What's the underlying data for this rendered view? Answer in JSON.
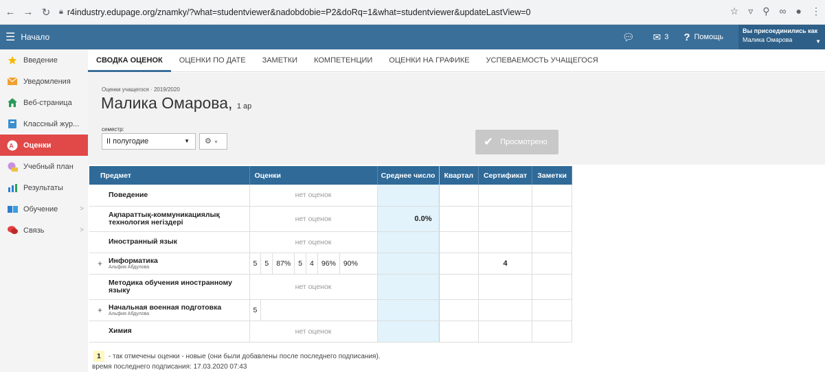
{
  "browser": {
    "url": "r4industry.edupage.org/znamky/?what=studentviewer&nadobdobie=P2&doRq=1&what=studentviewer&updateLastView=0"
  },
  "topbar": {
    "title": "Начало",
    "messages_count": "3",
    "help_label": "Помощь",
    "user_caption": "Вы присоединились как",
    "user_name": "Малика Омарова"
  },
  "sidebar": {
    "items": [
      {
        "label": "Введение",
        "icon": "star-icon"
      },
      {
        "label": "Уведомления",
        "icon": "mail-icon"
      },
      {
        "label": "Веб-страница",
        "icon": "home-icon"
      },
      {
        "label": "Классный жур...",
        "icon": "journal-icon"
      },
      {
        "label": "Оценки",
        "icon": "grades-icon"
      },
      {
        "label": "Учебный план",
        "icon": "plan-icon"
      },
      {
        "label": "Результаты",
        "icon": "bar-chart-icon"
      },
      {
        "label": "Обучение",
        "icon": "book-icon"
      },
      {
        "label": "Связь",
        "icon": "chat-icon"
      }
    ]
  },
  "tabs": [
    "СВОДКА ОЦЕНОК",
    "ОЦЕНКИ ПО ДАТЕ",
    "ЗАМЕТКИ",
    "КОМПЕТЕНЦИИ",
    "ОЦЕНКИ НА ГРАФИКЕ",
    "УСПЕВАЕМОСТЬ УЧАЩЕГОСЯ"
  ],
  "header": {
    "subtitle": "Оценки учащегося · 2019/2020",
    "student_name": "Малика Омарова,",
    "class": "1 ар",
    "semester_label": "семестр:",
    "semester_value": "II полугодие",
    "viewed_button": "Просмотрено"
  },
  "table": {
    "headers": {
      "subject": "Предмет",
      "grades": "Оценки",
      "average": "Среднее число",
      "quarter": "Квартал",
      "certificate": "Сертификат",
      "notes": "Заметки"
    },
    "rows": [
      {
        "subject": "Поведение",
        "teacher": "",
        "grades_text": "нет оценок",
        "average": "",
        "cert": ""
      },
      {
        "subject": "Ақпараттық-коммуникациялық технология негіздері",
        "teacher": "",
        "grades_text": "нет оценок",
        "average": "0.0%",
        "cert": ""
      },
      {
        "subject": "Иностранный язык",
        "teacher": "",
        "grades_text": "нет оценок",
        "average": "",
        "cert": ""
      },
      {
        "subject": "Информатика",
        "teacher": "Альфия Абдулова",
        "grades": [
          "5",
          "5",
          "87%",
          "5",
          "4",
          "96%",
          "90%"
        ],
        "average": "",
        "cert": "4"
      },
      {
        "subject": "Методика обучения иностранному языку",
        "teacher": "",
        "grades_text": "нет оценок",
        "average": "",
        "cert": ""
      },
      {
        "subject": "Начальная военная подготовка",
        "teacher": "Альфия Абдулова",
        "grades": [
          "5"
        ],
        "average": "",
        "cert": ""
      },
      {
        "subject": "Химия",
        "teacher": "",
        "grades_text": "нет оценок",
        "average": "",
        "cert": ""
      }
    ]
  },
  "legend": {
    "badge": "1",
    "text": "- так отмечены оценки - новые (они были добавлены после последнего подписания).",
    "last_sign": "время последнего подписания: 17.03.2020 07:43"
  }
}
